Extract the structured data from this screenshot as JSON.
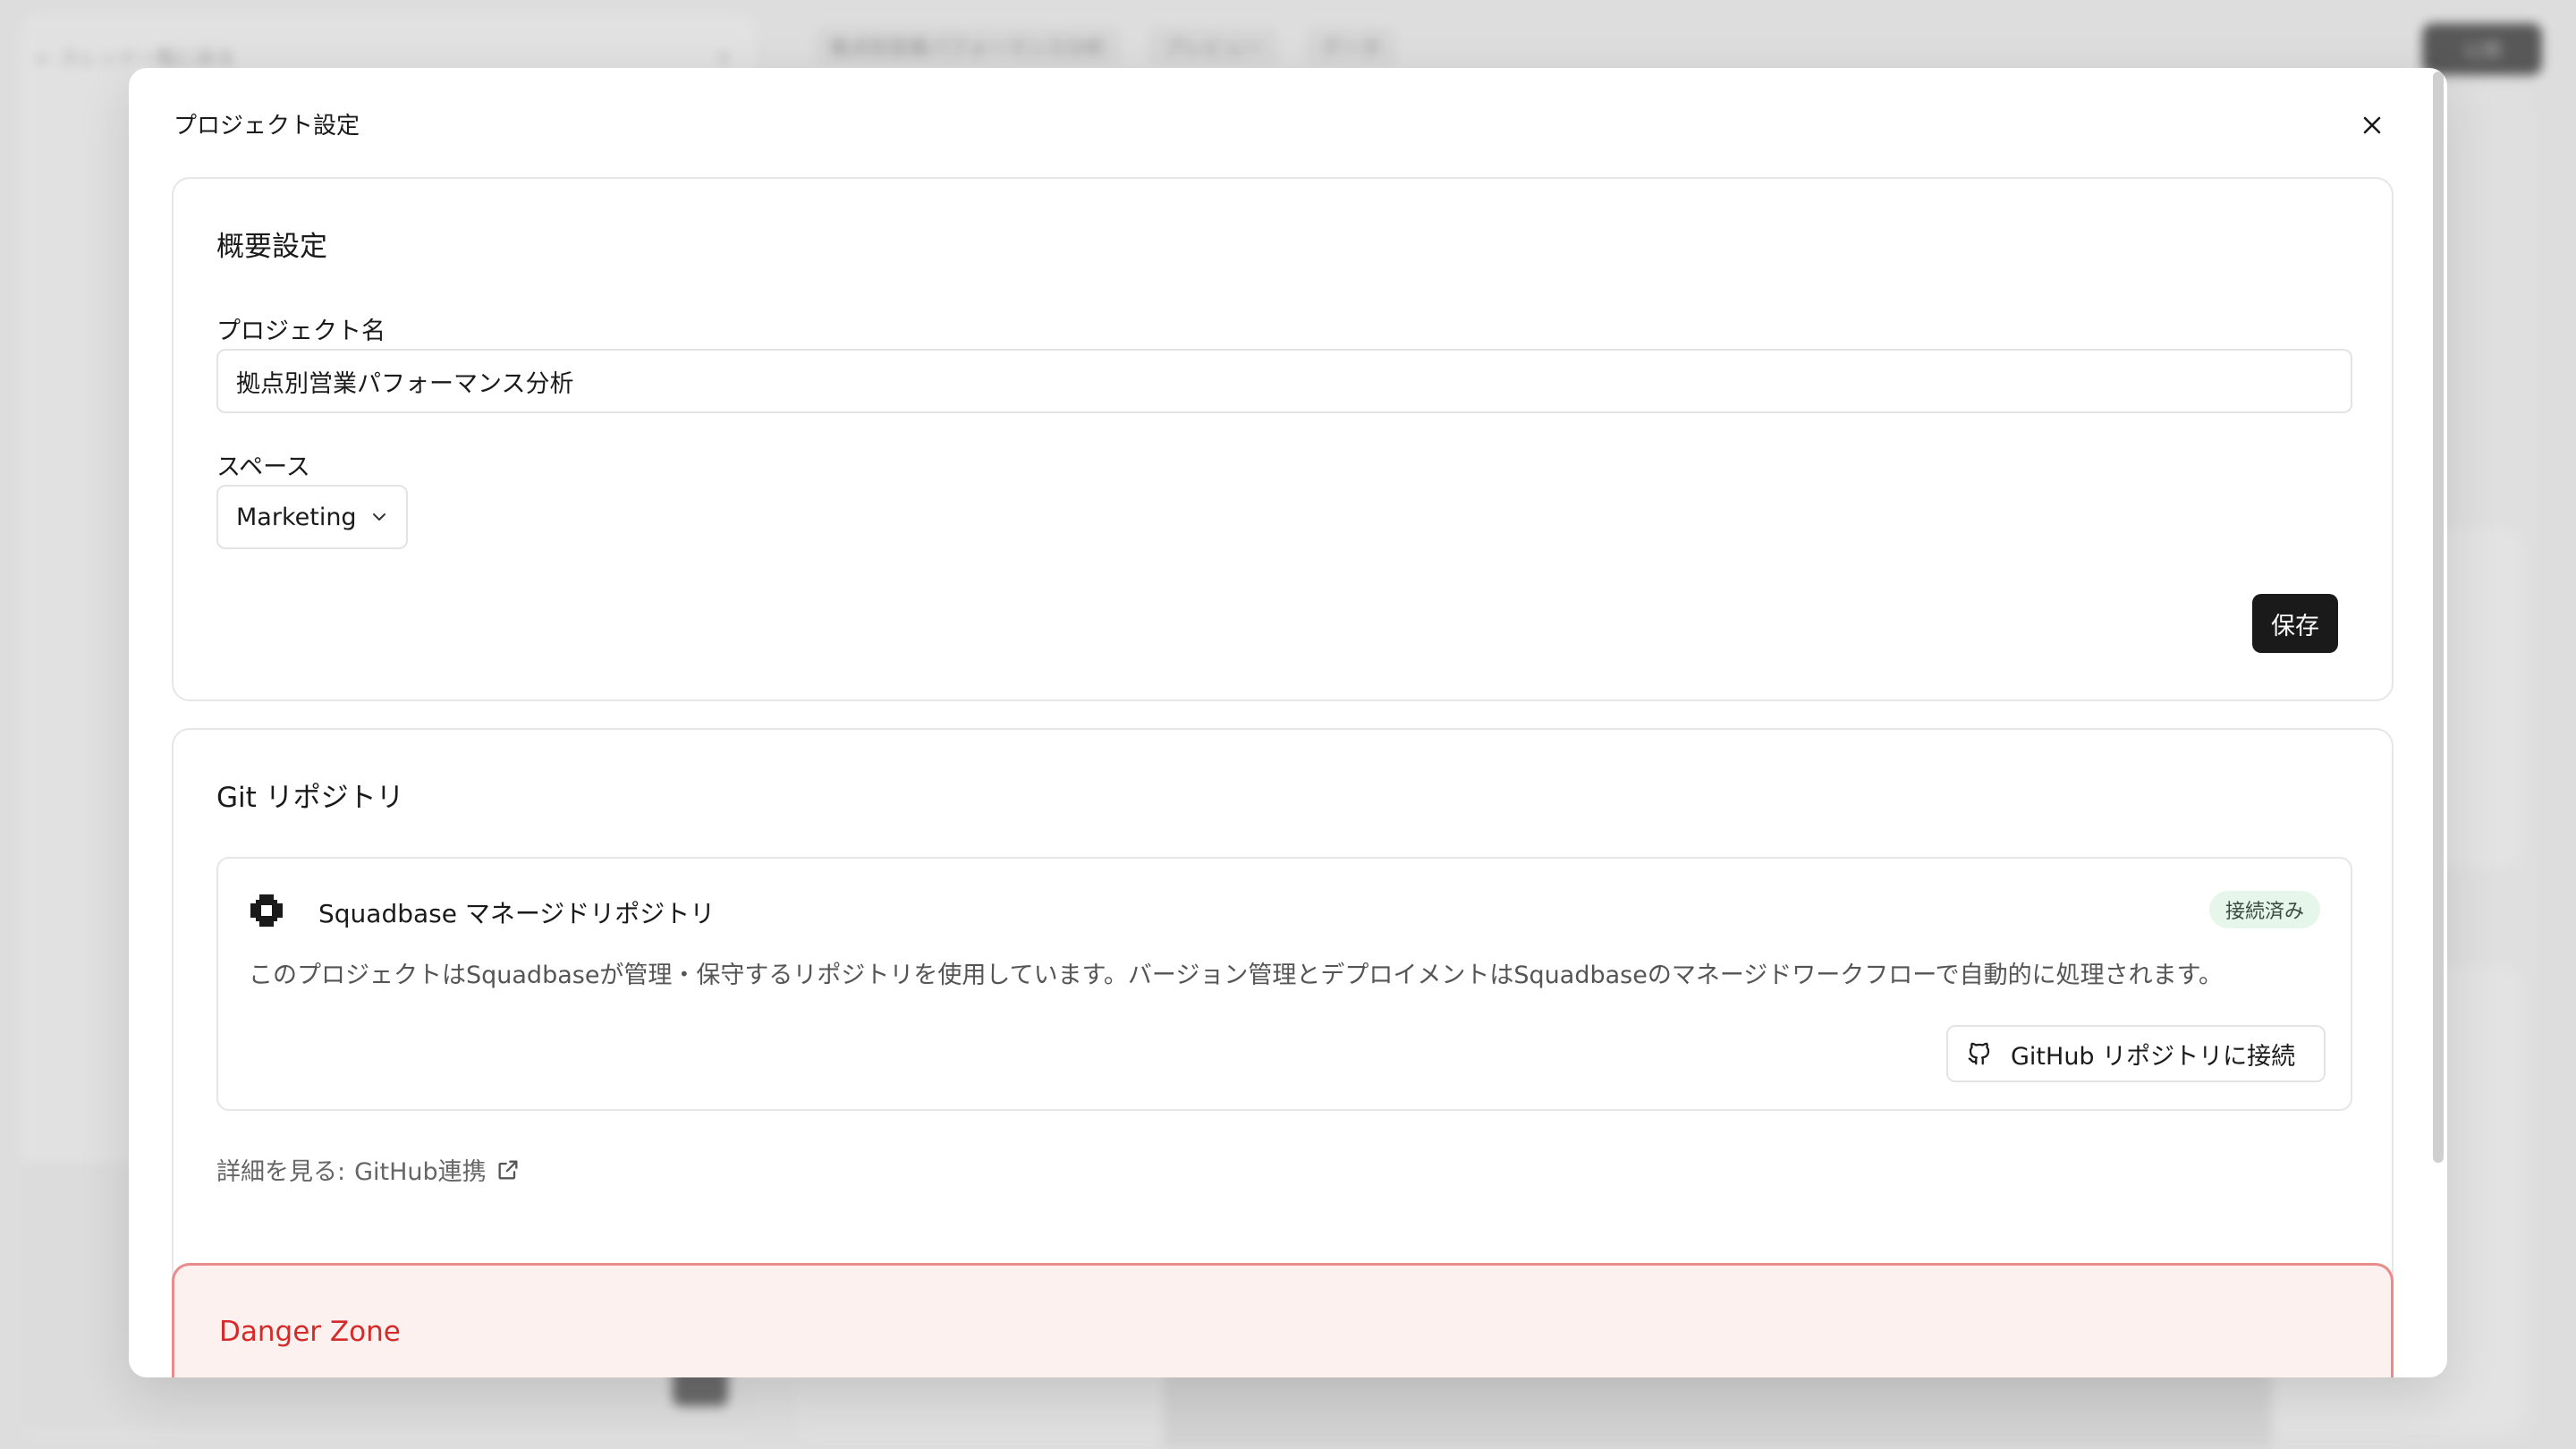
{
  "background": {
    "sidebar_header": "← スレッド一覧に戻る",
    "topbar_project": "拠点別営業パフォーマンス分析",
    "topbar_preview": "プレビュー",
    "topbar_data": "データ",
    "publish_label": "公開"
  },
  "modal": {
    "title": "プロジェクト設定",
    "close_icon": "close-icon"
  },
  "overview": {
    "heading": "概要設定",
    "name_label": "プロジェクト名",
    "name_value": "拠点別営業パフォーマンス分析",
    "space_label": "スペース",
    "space_value": "Marketing",
    "save_label": "保存"
  },
  "git": {
    "heading": "Git リポジトリ",
    "repo_name": "Squadbase マネージドリポジトリ",
    "status_badge": "接続済み",
    "description": "このプロジェクトはSquadbaseが管理・保守するリポジトリを使用しています。バージョン管理とデプロイメントはSquadbaseのマネージドワークフローで自動的に処理されます。",
    "connect_label": "GitHub リポジトリに接続",
    "more_prefix": "詳細を見る:",
    "more_link": "GitHub連携"
  },
  "danger": {
    "heading": "Danger Zone"
  },
  "colors": {
    "primary": "#1a1a1a",
    "danger": "#d42a2a",
    "danger_bg": "#fdf1f0",
    "badge_bg": "#e6f6ea"
  }
}
